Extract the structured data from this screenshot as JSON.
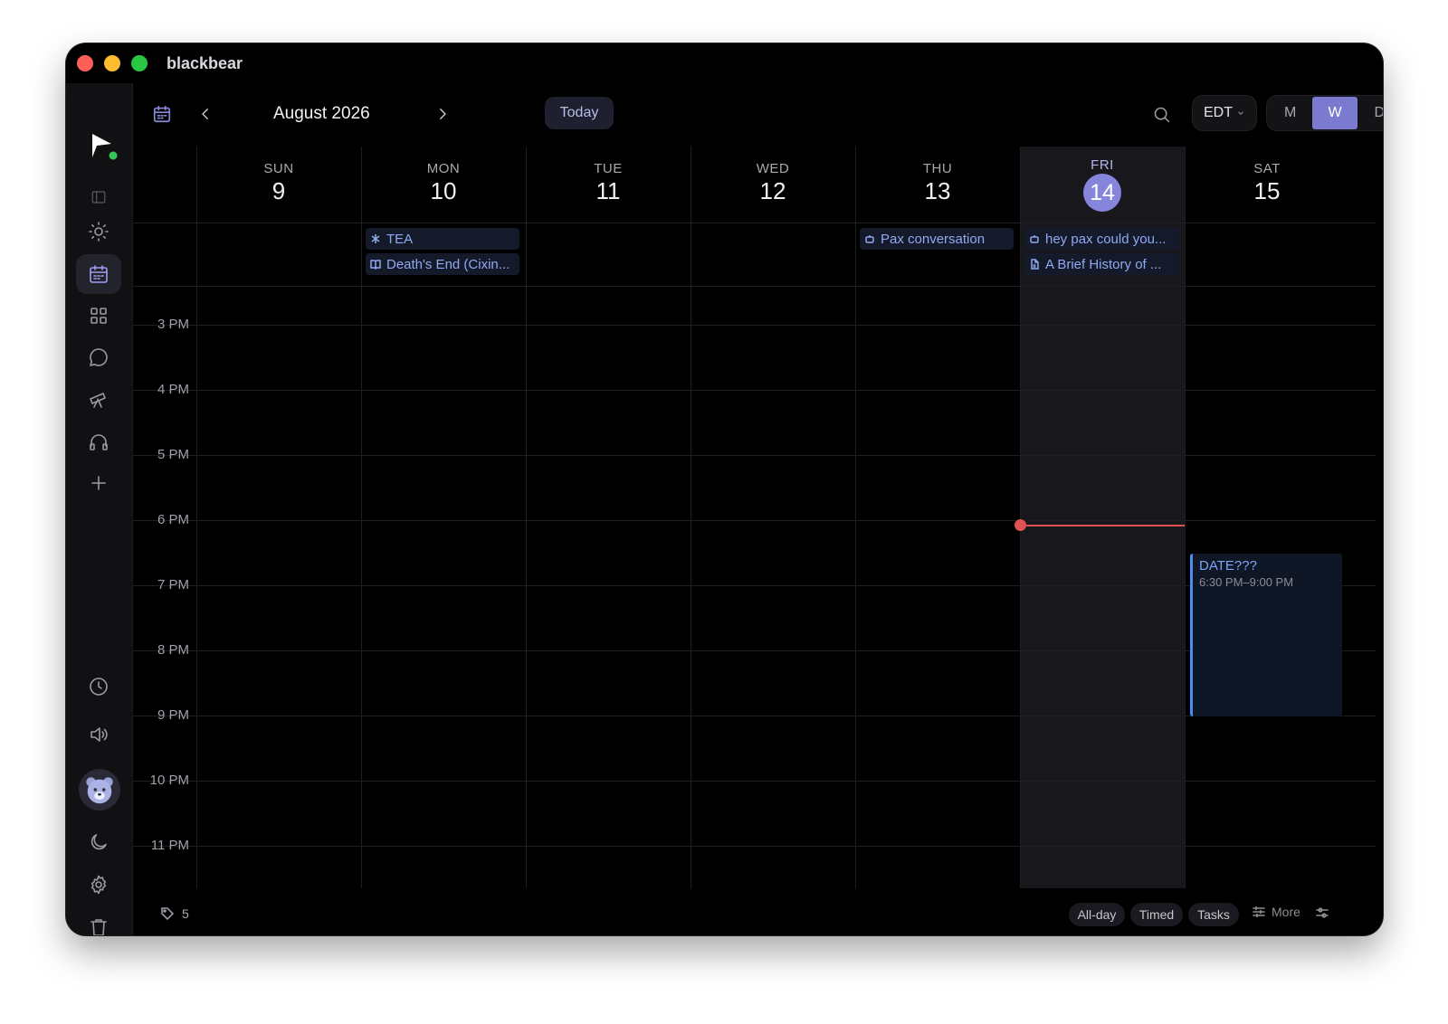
{
  "window": {
    "title": "blackbear"
  },
  "toolbar": {
    "month_label": "August 2026",
    "today_label": "Today",
    "timezone": "EDT",
    "views": [
      "M",
      "W",
      "D"
    ],
    "active_view": "W"
  },
  "days": [
    {
      "dow": "SUN",
      "num": "9"
    },
    {
      "dow": "MON",
      "num": "10"
    },
    {
      "dow": "TUE",
      "num": "11"
    },
    {
      "dow": "WED",
      "num": "12"
    },
    {
      "dow": "THU",
      "num": "13"
    },
    {
      "dow": "FRI",
      "num": "14",
      "today": true
    },
    {
      "dow": "SAT",
      "num": "15"
    }
  ],
  "allday_events": {
    "mon_1": {
      "title": "TEA",
      "icon": "sparkle-icon"
    },
    "mon_2": {
      "title": "Death's End (Cixin...",
      "icon": "book-icon"
    },
    "thu_1": {
      "title": "Pax conversation",
      "icon": "bot-icon"
    },
    "fri_1": {
      "title": "hey pax could you...",
      "icon": "bot-icon"
    },
    "fri_2": {
      "title": "A Brief History of ...",
      "icon": "document-icon"
    }
  },
  "time_labels": [
    "3 PM",
    "4 PM",
    "5 PM",
    "6 PM",
    "7 PM",
    "8 PM",
    "9 PM",
    "10 PM",
    "11 PM"
  ],
  "timed_events": {
    "sat_1": {
      "title": "DATE???",
      "time": "6:30 PM–9:00 PM"
    }
  },
  "colors": {
    "accent": "#7a7ad0",
    "today_badge": "#8585dc",
    "now_indicator": "#e05252",
    "event_blue": "#4a8df0"
  },
  "footer": {
    "tag_count": "5",
    "filters": [
      "All-day",
      "Timed",
      "Tasks"
    ],
    "more_label": "More"
  }
}
